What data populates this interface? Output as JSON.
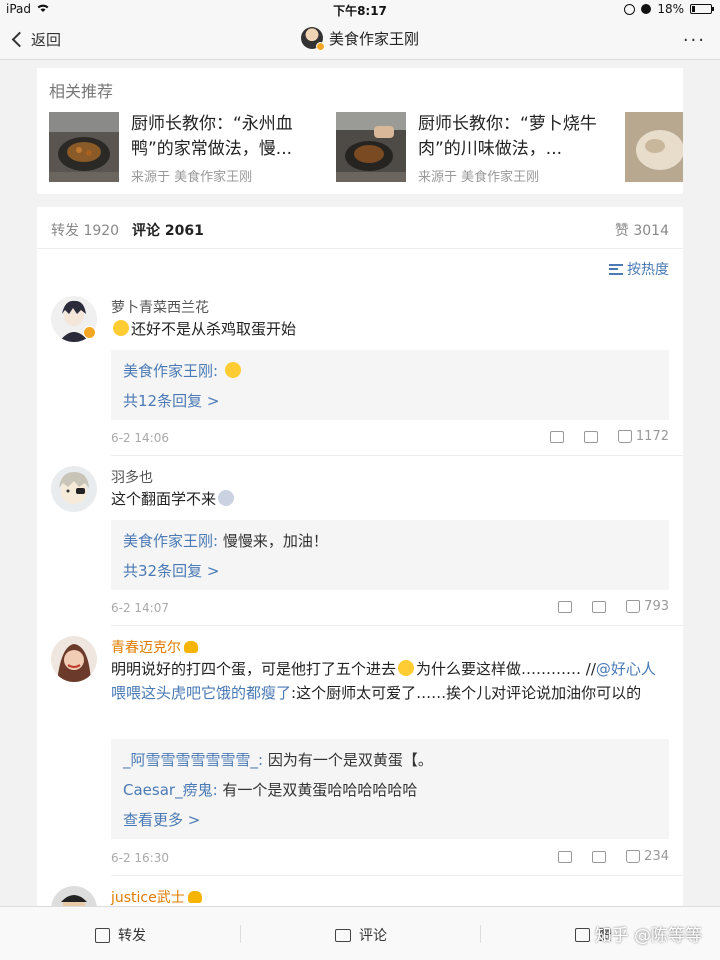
{
  "status": {
    "device": "iPad",
    "time": "下午8:17",
    "battery": "18%",
    "battery_level": 0.18
  },
  "nav": {
    "back_label": "返回",
    "title": "美食作家王刚",
    "more": "···"
  },
  "related": {
    "title": "相关推荐",
    "items": [
      {
        "title": "厨师长教你：“永州血鸭”的家常做法，慢...",
        "source": "来源于 美食作家王刚"
      },
      {
        "title": "厨师长教你：“萝卜烧牛肉”的川味做法，...",
        "source": "来源于 美食作家王刚"
      }
    ]
  },
  "tabs": {
    "repost": {
      "label": "转发",
      "count": "1920"
    },
    "comment": {
      "label": "评论",
      "count": "2061"
    },
    "like": {
      "label": "赞",
      "count": "3014"
    }
  },
  "sort": {
    "label": "按热度"
  },
  "comments": [
    {
      "name": "萝卜青菜西兰花",
      "text": "还好不是从杀鸡取蛋开始",
      "reply_user": "美食作家王刚:",
      "reply_more": "共12条回复 >",
      "time": "6-2 14:06",
      "likes": "1172"
    },
    {
      "name": "羽多也",
      "text": "这个翻面学不来",
      "reply_user": "美食作家王刚:",
      "reply_text": "慢慢来，加油！",
      "reply_more": "共32条回复 >",
      "time": "6-2 14:07",
      "likes": "793"
    },
    {
      "name": "青春迈克尔",
      "text_a": "明明说好的打四个蛋，可是他打了五个进去",
      "text_b": "为什么要这样做………… //",
      "text_link": "@好心人喂喂这头虎吧它饿的都瘦了",
      "text_c": ":这个厨师太可爱了……挨个儿对评论说加油你可以的",
      "reply1_user": "_阿雪雪雪雪雪雪雪_:",
      "reply1_text": "因为有一个是双黄蛋【。",
      "reply2_user": "Caesar_痨鬼:",
      "reply2_text": "有一个是双黄蛋哈哈哈哈哈哈",
      "reply_more": "查看更多 >",
      "time": "6-2 16:30",
      "likes": "234"
    },
    {
      "name": "justice武士"
    }
  ],
  "bottom": {
    "repost": "转发",
    "comment": "评论",
    "like": "赞",
    "watermark": "知乎 @陈等等"
  }
}
